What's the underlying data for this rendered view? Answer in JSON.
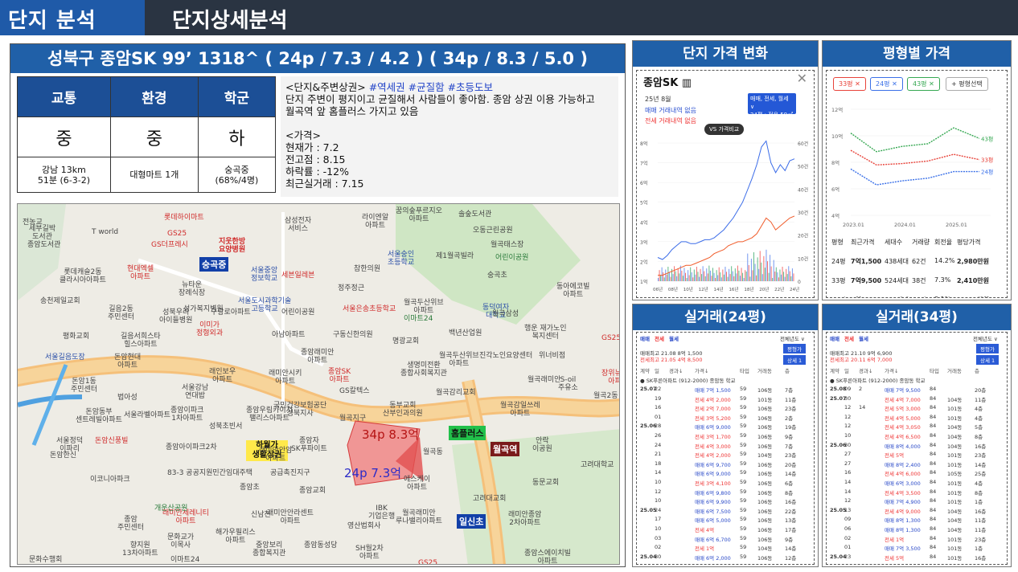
{
  "header": {
    "section": "단지 분석",
    "subtitle": "단지상세분석"
  },
  "title": "성북구 종암SK 99’ 1318^ ( 24p / 7.3 / 4.2 ) ( 34p / 8.3 / 5.0 )",
  "metrics": {
    "headers": [
      "교통",
      "환경",
      "학군"
    ],
    "grades": [
      "중",
      "중",
      "하"
    ],
    "details": [
      [
        "강남 13km",
        "51분 (6-3-2)"
      ],
      [
        "대형마트 1개"
      ],
      [
        "숭곡중",
        "(68%/4명)"
      ]
    ]
  },
  "description": {
    "heading": "<단지&주변상권>",
    "tags": "#역세권 #균질함 #초등도보",
    "lines": [
      "단지 주변이 평지이고 균질해서 사람들이 좋아함. 종암 상권 이용 가능하고",
      "월곡역 앞 홈플러스 가지고 있음"
    ],
    "price_heading": "<가격>",
    "price_lines": [
      "현재가 : 7.2",
      "전고점 : 8.15",
      "하락률 : -12%",
      "최근실거래 : 7.15"
    ]
  },
  "map": {
    "tags": {
      "school": "숭곡중",
      "homeplus": "홈플러스",
      "station1": "월곡역",
      "station2": "일신초",
      "commercial": "하월가\n생활상권",
      "p34": "34p 8.3억",
      "p24": "24p 7.3억"
    },
    "pois": [
      "전농교",
      "세부길박\n도서관",
      "T world",
      "GS25",
      "롯데하이마트",
      "GS더프레시",
      "지웃한방\n요양병원",
      "삼성전자\n서비스",
      "라이엔알\n아파트",
      "오동근린공원",
      "꿈의숲푸르지오\n아파트",
      "솔숲도서관",
      "롯데캐슬2동\n클라시아아파트",
      "현대엑셀\n아파트",
      "서울중앙\n정보학교",
      "세븐일레븐",
      "참한의원",
      "월곡태스장",
      "제1월곡빌라",
      "서울숭인\n초등학교",
      "어린이공원",
      "숭곡초",
      "뉴타운\n장례식장",
      "정주정근",
      "서울도시과학기술\n고등학교",
      "월곡두산위브\n아파트",
      "동덕여자\n대학교",
      "동아에코빌\n아파트",
      "송천제일교회",
      "길음2동\n주민센터",
      "성북우리\n아이들병원",
      "성가복지병원",
      "이미가\n정형외과",
      "어린이공원",
      "서울은송초등학교",
      "이마트24",
      "명광교회",
      "GS25",
      "행운 재가노인\n복지센터",
      "평화교회",
      "길음서희스타\n힐스아파트",
      "아남아파트",
      "구동신한의원",
      "백년산업원",
      "월곡두산위브\n아파트",
      "돈암현대\n아파트",
      "종암래미안\n아파트",
      "래미안시키\n아파트",
      "진각노인요양센터",
      "위너비점",
      "장위뉴타운\n아파트",
      "래인보우\n아파트",
      "종암SK\n아파트",
      "생명미전환\n종합사회복지관",
      "월곡래미안",
      "S-oil\n주유소",
      "월곡2동",
      "돈암1동\n주민센터",
      "법아성",
      "서울강남\n연대밥",
      "GS칼텍스",
      "월곡감리교회",
      "월곡지구",
      "돈암동부\n센트레빌아파트",
      "서울라벨아파트",
      "국민건강보험공단\n성북지사",
      "동부교회\n산부인과의원",
      "월곡감일쓰레\n아파트",
      "종암이파크\n1차아파트",
      "성북초빈서",
      "종암우림카이저\n팰리스아파트",
      "돈암신풍빌",
      "서울정덕\n이파리",
      "래미안안암\n아파트",
      "종암자\nSK푸파이트",
      "월곡동",
      "안락\n이공원",
      "돈암한신",
      "종암아이파크2차",
      "83-3 공공지원민간임대주택",
      "공급촉진지구",
      "종암초",
      "고려대학교",
      "이코니아파크",
      "종암교회",
      "IBK\n기업은행",
      "에스케이\n아파트",
      "동문교회",
      "고려대교회",
      "래미안세레니티\n아파트",
      "종암\n주민센터",
      "래미안안라센트\n아파트",
      "월곡래미안\n루나밸리아파트",
      "래미안종암\n2차아파트",
      "문화교가\n이목사",
      "해가우필리스\n아파트",
      "영산법회사",
      "향지원\n13차아파트",
      "중앙보리\n종합복지관",
      "종암동성당",
      "SH월2차\n아파트",
      "종암스에이치빌\n아파트",
      "이마트24",
      "GS25",
      "개운산공원",
      "문화수행회",
      "신남천",
      "서울길음도장",
      "종암도서관",
      "월곡삼성",
      "구광로아파트"
    ]
  },
  "chart1": {
    "header": "단지 가격 변화",
    "name": "종암SK",
    "close": "✕",
    "month": "25년 8월",
    "line1": "매매 거래내역 없음",
    "line2": "전세 거래내역 없음",
    "selector": "매매, 전세, 월세 ∨",
    "selector2": "24평 : 전용 59㎡",
    "vs": "VS 가격비교",
    "y_left": [
      "8억",
      "7억",
      "6억",
      "5억",
      "4억",
      "3억",
      "2억",
      "1억"
    ],
    "y_right": [
      "60건",
      "50건",
      "40건",
      "30건",
      "20건",
      "10건",
      "0"
    ],
    "x_labels": [
      "06년",
      "08년",
      "10년",
      "12년",
      "14년",
      "16년",
      "18년",
      "20년",
      "22년",
      "24년"
    ],
    "colors": {
      "sale": "#3b6ce8",
      "jeonse": "#f05a28",
      "vol_red": "#e33",
      "vol_green": "#1f9d55",
      "vol_blue": "#3b6ce8"
    }
  },
  "chart_data": {
    "type": "line",
    "title": "",
    "xlabel": "",
    "ylabel": "",
    "x": [
      "2023.01",
      "2023.07",
      "2024.01",
      "2024.07",
      "2025.01",
      "2025.07"
    ],
    "ylim": [
      4,
      12
    ],
    "series": [
      {
        "name": "43평",
        "values": [
          10.2,
          8.8,
          9.2,
          9.4,
          10.6,
          9.8
        ]
      },
      {
        "name": "33평",
        "values": [
          8.9,
          7.8,
          7.9,
          8.1,
          8.6,
          8.2
        ]
      },
      {
        "name": "24평",
        "values": [
          7.5,
          6.3,
          6.6,
          6.8,
          7.3,
          7.3
        ]
      }
    ],
    "yticks": [
      "12억",
      "10억",
      "8억",
      "6억",
      "4억"
    ]
  },
  "chart2": {
    "header": "평형별 가격",
    "pills": [
      "33평 ✕",
      "24평 ✕",
      "43평 ✕",
      "+ 평형선택"
    ],
    "colors": {
      "43평": "#36a852",
      "33평": "#e8433a",
      "24평": "#3a70e8"
    },
    "table_headers": [
      "평형",
      "최근가격",
      "세대수",
      "거래량",
      "회전율",
      "평당가격"
    ],
    "rows": [
      [
        "24평",
        "7억1,500",
        "438세대",
        "62건",
        "14.2%",
        "2,980만원"
      ],
      [
        "33평",
        "7억9,500",
        "524세대",
        "38건",
        "7.3%",
        "2,410만원"
      ],
      [
        "43평",
        "9억1,000",
        "356세대",
        "11건",
        "3.1%",
        "2,117만원"
      ]
    ]
  },
  "trades24": {
    "header": "실거래(24평)",
    "tabs": [
      "매매",
      "전세",
      "월세"
    ],
    "year": "전체년도 ∨",
    "summary": [
      "매매최고 21.08 8억 1,500",
      "전세최고 21.05 4억 8,500"
    ],
    "btn1": "평형가",
    "btn2": "상세 1",
    "cols": [
      "계약",
      "일",
      "경과↓",
      "가격↓",
      "타입",
      "거래동",
      "층"
    ],
    "rows": [
      [
        "25.07",
        "22",
        "",
        "매매 7억 1,500",
        "59",
        "106동",
        "7층"
      ],
      [
        "",
        "19",
        "",
        "전세 4억 2,000",
        "59",
        "101동",
        "11층"
      ],
      [
        "",
        "16",
        "",
        "전세 2억 7,000",
        "59",
        "106동",
        "23층"
      ],
      [
        "",
        "01",
        "",
        "전세 3억 5,200",
        "59",
        "106동",
        "2층"
      ],
      [
        "25.06",
        "28",
        "",
        "매매 6억 9,000",
        "59",
        "106동",
        "19층"
      ],
      [
        "",
        "26",
        "",
        "전세 3억 1,700",
        "59",
        "106동",
        "9층"
      ],
      [
        "",
        "24",
        "",
        "전세 4억 3,000",
        "59",
        "106동",
        "7층"
      ],
      [
        "",
        "21",
        "",
        "전세 4억 2,000",
        "59",
        "104동",
        "23층"
      ],
      [
        "",
        "18",
        "",
        "매매 6억 9,700",
        "59",
        "106동",
        "20층"
      ],
      [
        "",
        "14",
        "",
        "매매 6억 9,000",
        "59",
        "106동",
        "14층"
      ],
      [
        "",
        "10",
        "",
        "전세 3억 4,100",
        "59",
        "106동",
        "6층"
      ],
      [
        "",
        "12",
        "",
        "매매 6억 9,800",
        "59",
        "106동",
        "8층"
      ],
      [
        "",
        "10",
        "",
        "매매 6억 9,900",
        "59",
        "106동",
        "16층"
      ],
      [
        "25.05",
        "24",
        "",
        "매매 6억 7,500",
        "59",
        "106동",
        "22층"
      ],
      [
        "",
        "17",
        "",
        "매매 6억 5,000",
        "59",
        "106동",
        "13층"
      ],
      [
        "",
        "10",
        "",
        "전세 4억",
        "59",
        "106동",
        "17층"
      ],
      [
        "",
        "03",
        "",
        "매매 6억 6,700",
        "59",
        "106동",
        "9층"
      ],
      [
        "",
        "02",
        "",
        "전세 1억",
        "59",
        "104동",
        "14층"
      ],
      [
        "25.04",
        "30",
        "",
        "매매 6억 2,000",
        "59",
        "106동",
        "12층"
      ]
    ]
  },
  "trades34": {
    "header": "실거래(34평)",
    "tabs": [
      "매매",
      "전세",
      "월세"
    ],
    "year": "전체년도 ∨",
    "summary": [
      "매매최고 21.10 9억 6,900",
      "전세최고 20.11 6억 7,000"
    ],
    "btn1": "평형가",
    "btn2": "상세 1",
    "cols": [
      "계약",
      "일",
      "경과↓",
      "가격↓",
      "타입",
      "거래동",
      "층"
    ],
    "rows": [
      [
        "25.08",
        "09",
        "2",
        "매매 7억 9,500",
        "84",
        "",
        "20층"
      ],
      [
        "25.07",
        "30",
        "",
        "전세 4억 7,000",
        "84",
        "104동",
        "11층"
      ],
      [
        "",
        "12",
        "14",
        "전세 5억 3,000",
        "84",
        "101동",
        "4층"
      ],
      [
        "",
        "12",
        "",
        "전세 4억 5,000",
        "84",
        "101동",
        "4층"
      ],
      [
        "",
        "12",
        "",
        "전세 4억 3,050",
        "84",
        "104동",
        "5층"
      ],
      [
        "",
        "10",
        "",
        "전세 4억 6,500",
        "84",
        "104동",
        "8층"
      ],
      [
        "25.06",
        "30",
        "",
        "매매 8억 4,000",
        "84",
        "104동",
        "16층"
      ],
      [
        "",
        "27",
        "",
        "전세 5억",
        "84",
        "101동",
        "23층"
      ],
      [
        "",
        "27",
        "",
        "매매 8억 2,400",
        "84",
        "101동",
        "14층"
      ],
      [
        "",
        "16",
        "",
        "전세 4억 6,000",
        "84",
        "105동",
        "25층"
      ],
      [
        "",
        "14",
        "",
        "매매 6억 3,000",
        "84",
        "101동",
        "4층"
      ],
      [
        "",
        "14",
        "",
        "전세 4억 3,500",
        "84",
        "101동",
        "8층"
      ],
      [
        "",
        "12",
        "",
        "매매 7억 4,900",
        "84",
        "101동",
        "1층"
      ],
      [
        "25.05",
        "13",
        "",
        "전세 4억 9,000",
        "84",
        "104동",
        "16층"
      ],
      [
        "",
        "09",
        "",
        "매매 8억 1,300",
        "84",
        "104동",
        "11층"
      ],
      [
        "",
        "06",
        "",
        "매매 8억 1,300",
        "84",
        "104동",
        "11층"
      ],
      [
        "",
        "02",
        "",
        "전세 1억",
        "84",
        "101동",
        "23층"
      ],
      [
        "",
        "01",
        "",
        "매매 7억 3,500",
        "84",
        "101동",
        "1층"
      ],
      [
        "25.04",
        "23",
        "",
        "전세 5억",
        "84",
        "101동",
        "16층"
      ]
    ]
  }
}
